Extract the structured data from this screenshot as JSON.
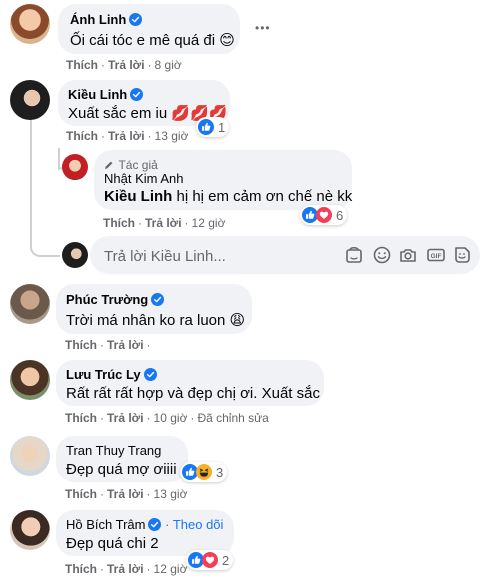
{
  "comments": [
    {
      "name": "Ánh Linh",
      "text": "Ối cái tóc e mê quá đi 😊",
      "like": "Thích",
      "reply": "Trả lời",
      "time": "8 giờ",
      "verified": true
    },
    {
      "name": "Kiều Linh",
      "text": "Xuất sắc em iu 💋💋💋",
      "like": "Thích",
      "reply": "Trả lời",
      "time": "13 giờ",
      "reactions": "1",
      "verified": true,
      "replies": [
        {
          "author_tag": "Tác giả",
          "name": "Nhật Kim Anh",
          "mention": "Kiều Linh",
          "text": " hị hị em cảm ơn chế nè kk",
          "like": "Thích",
          "reply": "Trả lời",
          "time": "12 giờ",
          "reactions": "6"
        }
      ],
      "reply_placeholder": "Trả lời Kiều Linh..."
    },
    {
      "name": "Phúc Trường",
      "text": "Trời má nhân ko ra luon 😩",
      "like": "Thích",
      "reply": "Trả lời",
      "verified": true
    },
    {
      "name": "Lưu Trúc Ly",
      "text": "Rất rất rất hợp và đẹp chị ơi. Xuất sắc",
      "like": "Thích",
      "reply": "Trả lời",
      "time": "10 giờ",
      "edited": "Đã chỉnh sửa",
      "verified": true
    },
    {
      "name": "Tran Thuy Trang",
      "text": "Đẹp quá mợ ơiiii",
      "like": "Thích",
      "reply": "Trả lời",
      "time": "13 giờ",
      "reactions": "3"
    },
    {
      "name": "Hồ Bích Trâm",
      "follow": "Theo dõi",
      "text": "Đẹp quá chi 2",
      "like": "Thích",
      "reply": "Trả lời",
      "time": "12 giờ",
      "reactions": "2",
      "verified": true
    }
  ],
  "more_options": "•••",
  "colors": {
    "accent": "#1877f2",
    "bubble": "#f0f2f5",
    "meta": "#65676b",
    "love": "#f33e58",
    "haha": "#f7b125"
  },
  "icons": [
    "verified-badge-icon",
    "like-reaction-icon",
    "love-reaction-icon",
    "haha-reaction-icon",
    "pencil-icon",
    "sticker-icon",
    "emoji-icon",
    "camera-icon",
    "gif-icon",
    "avatar-sticker-icon"
  ]
}
